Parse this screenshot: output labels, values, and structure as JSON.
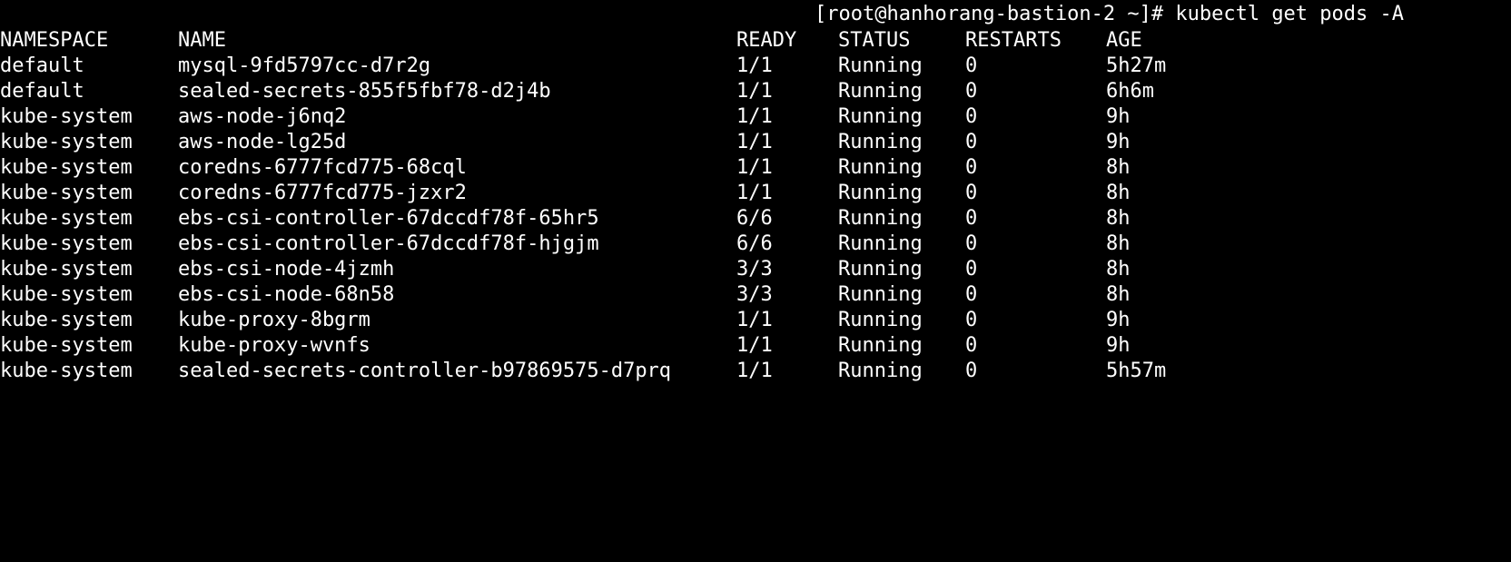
{
  "terminal": {
    "background": "#000000",
    "foreground": "#ffffff",
    "prompt": "[root@hanhorang-bastion-2 ~]# kubectl get pods -A"
  },
  "table": {
    "headers": {
      "namespace": "NAMESPACE",
      "name": "NAME",
      "ready": "READY",
      "status": "STATUS",
      "restarts": "RESTARTS",
      "age": "AGE"
    },
    "rows": [
      {
        "namespace": "default",
        "name": "mysql-9fd5797cc-d7r2g",
        "ready": "1/1",
        "status": "Running",
        "restarts": "0",
        "age": "5h27m"
      },
      {
        "namespace": "default",
        "name": "sealed-secrets-855f5fbf78-d2j4b",
        "ready": "1/1",
        "status": "Running",
        "restarts": "0",
        "age": "6h6m"
      },
      {
        "namespace": "kube-system",
        "name": "aws-node-j6nq2",
        "ready": "1/1",
        "status": "Running",
        "restarts": "0",
        "age": "9h"
      },
      {
        "namespace": "kube-system",
        "name": "aws-node-lg25d",
        "ready": "1/1",
        "status": "Running",
        "restarts": "0",
        "age": "9h"
      },
      {
        "namespace": "kube-system",
        "name": "coredns-6777fcd775-68cql",
        "ready": "1/1",
        "status": "Running",
        "restarts": "0",
        "age": "8h"
      },
      {
        "namespace": "kube-system",
        "name": "coredns-6777fcd775-jzxr2",
        "ready": "1/1",
        "status": "Running",
        "restarts": "0",
        "age": "8h"
      },
      {
        "namespace": "kube-system",
        "name": "ebs-csi-controller-67dccdf78f-65hr5",
        "ready": "6/6",
        "status": "Running",
        "restarts": "0",
        "age": "8h"
      },
      {
        "namespace": "kube-system",
        "name": "ebs-csi-controller-67dccdf78f-hjgjm",
        "ready": "6/6",
        "status": "Running",
        "restarts": "0",
        "age": "8h"
      },
      {
        "namespace": "kube-system",
        "name": "ebs-csi-node-4jzmh",
        "ready": "3/3",
        "status": "Running",
        "restarts": "0",
        "age": "8h"
      },
      {
        "namespace": "kube-system",
        "name": "ebs-csi-node-68n58",
        "ready": "3/3",
        "status": "Running",
        "restarts": "0",
        "age": "8h"
      },
      {
        "namespace": "kube-system",
        "name": "kube-proxy-8bgrm",
        "ready": "1/1",
        "status": "Running",
        "restarts": "0",
        "age": "9h"
      },
      {
        "namespace": "kube-system",
        "name": "kube-proxy-wvnfs",
        "ready": "1/1",
        "status": "Running",
        "restarts": "0",
        "age": "9h"
      },
      {
        "namespace": "kube-system",
        "name": "sealed-secrets-controller-b97869575-d7prq",
        "ready": "1/1",
        "status": "Running",
        "restarts": "0",
        "age": "5h57m"
      }
    ]
  }
}
